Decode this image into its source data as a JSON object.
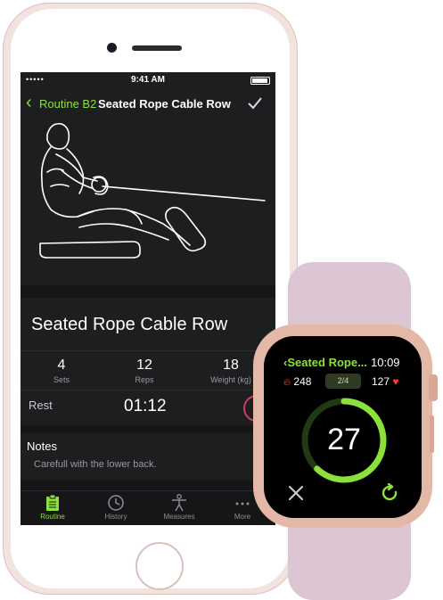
{
  "phone": {
    "status": {
      "signal": "•••••",
      "time": "9:41 AM"
    },
    "nav": {
      "back_label": "Routine B2",
      "title": "Seated Rope Cable Row"
    },
    "exercise_name": "Seated Rope Cable Row",
    "stats": [
      {
        "value": "4",
        "label": "Sets"
      },
      {
        "value": "12",
        "label": "Reps"
      },
      {
        "value": "18",
        "label": "Weight (kg)"
      }
    ],
    "rest": {
      "label": "Rest",
      "time": "01:12"
    },
    "notes": {
      "heading": "Notes",
      "text": "Carefull with the lower back."
    },
    "tabs": [
      {
        "label": "Routine",
        "icon": "clipboard-icon",
        "active": true
      },
      {
        "label": "History",
        "icon": "clock-icon",
        "active": false
      },
      {
        "label": "Measures",
        "icon": "body-icon",
        "active": false
      },
      {
        "label": "More",
        "icon": "more-icon",
        "active": false
      }
    ],
    "accent": "#8ce03a"
  },
  "watch": {
    "title": "Seated Rope...",
    "time": "10:09",
    "calories": "248",
    "set_progress": "2/4",
    "heart_rate": "127",
    "count": "27",
    "ring_fraction": 0.62,
    "accent": "#8ce03a"
  }
}
